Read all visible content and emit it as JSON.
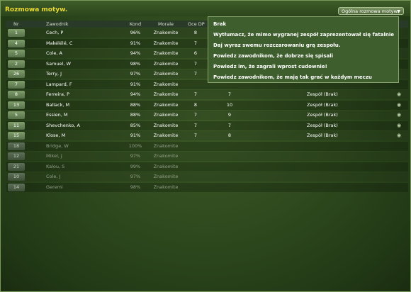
{
  "window": {
    "title": "Rozmowa motyw."
  },
  "dropdown": {
    "label": "Ogólna rozmowa motyw.",
    "icon": "chevron-down-icon"
  },
  "columns": {
    "nr": "Nr",
    "player": "Zawodnik",
    "kond": "Kond",
    "morale": "Morale",
    "oce": "Oce DP"
  },
  "players": [
    {
      "nr": "1",
      "name": "Cech, P",
      "kond": "96%",
      "morale": "Znakomite",
      "oce": "8",
      "dp": "",
      "team": "",
      "icon": "",
      "dim": false
    },
    {
      "nr": "4",
      "name": "Makélélé, C",
      "kond": "91%",
      "morale": "Znakomite",
      "oce": "7",
      "dp": "",
      "team": "",
      "icon": "",
      "dim": false
    },
    {
      "nr": "5",
      "name": "Cole, A",
      "kond": "94%",
      "morale": "Znakomite",
      "oce": "6",
      "dp": "",
      "team": "",
      "icon": "",
      "dim": false
    },
    {
      "nr": "2",
      "name": "Samuel, W",
      "kond": "98%",
      "morale": "Znakomite",
      "oce": "7",
      "dp": "",
      "team": "",
      "icon": "",
      "dim": false
    },
    {
      "nr": "26",
      "name": "Terry, J",
      "kond": "97%",
      "morale": "Znakomite",
      "oce": "7",
      "dp": "",
      "team": "",
      "icon": "",
      "dim": false
    },
    {
      "nr": "7",
      "name": "Lampard, F",
      "kond": "91%",
      "morale": "Znakomite",
      "oce": "",
      "dp": "",
      "team": "",
      "icon": "",
      "dim": false
    },
    {
      "nr": "8",
      "name": "Ferreira, P",
      "kond": "94%",
      "morale": "Znakomite",
      "oce": "7",
      "dp": "7",
      "team": "Zespół (Brak)",
      "icon": "◉",
      "dim": false
    },
    {
      "nr": "13",
      "name": "Ballack, M",
      "kond": "88%",
      "morale": "Znakomite",
      "oce": "8",
      "dp": "10",
      "team": "Zespół (Brak)",
      "icon": "◉",
      "dim": false
    },
    {
      "nr": "5",
      "name": "Essien, M",
      "kond": "88%",
      "morale": "Znakomite",
      "oce": "7",
      "dp": "9",
      "team": "Zespół (Brak)",
      "icon": "◉",
      "dim": false
    },
    {
      "nr": "11",
      "name": "Shevchenko, A",
      "kond": "85%",
      "morale": "Znakomite",
      "oce": "7",
      "dp": "7",
      "team": "Zespół (Brak)",
      "icon": "◉",
      "dim": false
    },
    {
      "nr": "15",
      "name": "Klose, M",
      "kond": "91%",
      "morale": "Znakomite",
      "oce": "7",
      "dp": "8",
      "team": "Zespół (Brak)",
      "icon": "◉",
      "dim": false
    },
    {
      "nr": "18",
      "name": "Bridge, W",
      "kond": "100%",
      "morale": "Znakomite",
      "oce": "",
      "dp": "",
      "team": "",
      "icon": "",
      "dim": true
    },
    {
      "nr": "12",
      "name": "Mikel, J",
      "kond": "97%",
      "morale": "Znakomite",
      "oce": "",
      "dp": "",
      "team": "",
      "icon": "",
      "dim": true
    },
    {
      "nr": "21",
      "name": "Kalou, S",
      "kond": "99%",
      "morale": "Znakomite",
      "oce": "",
      "dp": "",
      "team": "",
      "icon": "",
      "dim": true
    },
    {
      "nr": "10",
      "name": "Cole, J",
      "kond": "97%",
      "morale": "Znakomite",
      "oce": "",
      "dp": "",
      "team": "",
      "icon": "",
      "dim": true
    },
    {
      "nr": "14",
      "name": "Geremi",
      "kond": "98%",
      "morale": "Znakomite",
      "oce": "",
      "dp": "",
      "team": "",
      "icon": "",
      "dim": true
    }
  ],
  "menu": {
    "items": [
      "Brak",
      "Wytłumacz, że mimo wygranej zespół zaprezentował się fatalnie",
      "Daj wyraz swemu rozczarowaniu grą zespołu.",
      "Powiedz zawodnikom, że dobrze się spisali",
      "Powiedz im, że zagrali wprost cudownie!",
      "Powiedz zawodnikom, że mają tak grać w każdym meczu"
    ]
  },
  "colors": {
    "title": "#e8d830",
    "menu_bg": "#3f5e2e",
    "row_num_bg": "#7f9d6a"
  }
}
